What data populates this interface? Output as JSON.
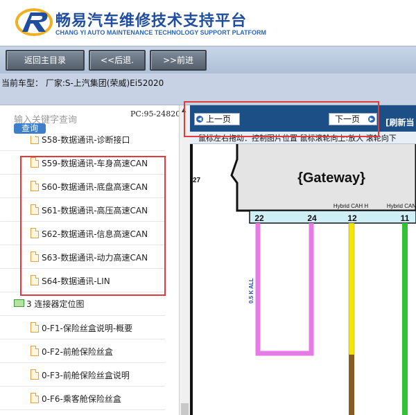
{
  "header": {
    "title_cn": "畅易汽车维修技术支持平台",
    "title_en": "CHANG YI AUTO MAINTENANCE TECHNOLOGY SUPPORT PLATFORM"
  },
  "nav": {
    "home": "返回主目录",
    "back": "<<后退.",
    "forward": ">>前进"
  },
  "model": {
    "text": "当前车型： 厂家:S-上汽集团(荣威)Ei52020"
  },
  "left": {
    "search_placeholder": "输入关键字查询",
    "search_button": "查询",
    "pc_code": "PC:95-24820",
    "tree": [
      {
        "label": "S58-数据通讯-诊断接口",
        "type": "doc"
      },
      {
        "label": "S59-数据通讯-车身高速CAN",
        "type": "doc"
      },
      {
        "label": "S60-数据通讯-底盘高速CAN",
        "type": "doc"
      },
      {
        "label": "S61-数据通讯-高压高速CAN",
        "type": "doc"
      },
      {
        "label": "S62-数据通讯-信息高速CAN",
        "type": "doc"
      },
      {
        "label": "S63-数据通讯-动力高速CAN",
        "type": "doc"
      },
      {
        "label": "S64-数据通讯-LIN",
        "type": "doc"
      },
      {
        "label": "3 连接器定位图",
        "type": "folder"
      },
      {
        "label": "0-F1-保险丝盒说明-概要",
        "type": "doc"
      },
      {
        "label": "0-F2-前舱保险丝盒",
        "type": "doc"
      },
      {
        "label": "0-F3-前舱保险丝盒说明",
        "type": "doc"
      },
      {
        "label": "0-F6-乘客舱保险丝盒",
        "type": "doc"
      }
    ]
  },
  "right": {
    "prev_page": "上一页",
    "next_page": "下一页",
    "refresh": "[刷新当",
    "hint": "鼠标左右拖动：控制图片位置  鼠标滚轮向上:放大  滚轮向下",
    "diagram": {
      "module": "{Gateway}",
      "pins": [
        "22",
        "24",
        "12",
        "11"
      ],
      "pin_left": "27",
      "wire_labels": [
        "Hybrid CAH H",
        "Hybrid CAN"
      ],
      "vertical_text": "0.5 K ALL",
      "colors": {
        "pink": "#e67ae6",
        "yellow": "#f5e600",
        "brown": "#8a5a1e",
        "green": "#33c233"
      }
    }
  },
  "colors": {
    "brand_blue": "#1f4ea0",
    "pager_bar": "#1b4f86",
    "highlight_red": "#e03a3a"
  }
}
